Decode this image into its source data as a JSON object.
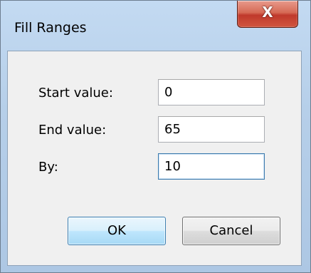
{
  "window": {
    "title": "Fill Ranges",
    "close_label": "X"
  },
  "form": {
    "start_label": "Start value:",
    "start_value": "0",
    "end_label": "End value:",
    "end_value": "65",
    "by_label": "By:",
    "by_value": "10"
  },
  "buttons": {
    "ok_label": "OK",
    "cancel_label": "Cancel"
  },
  "icons": {
    "close": "close-icon"
  },
  "colors": {
    "frame": "#b6cfe9",
    "close_button": "#c0392b",
    "client_background": "#f0f0f0",
    "default_button_border": "#3c7fb1",
    "focus_border": "#3d7bad"
  }
}
